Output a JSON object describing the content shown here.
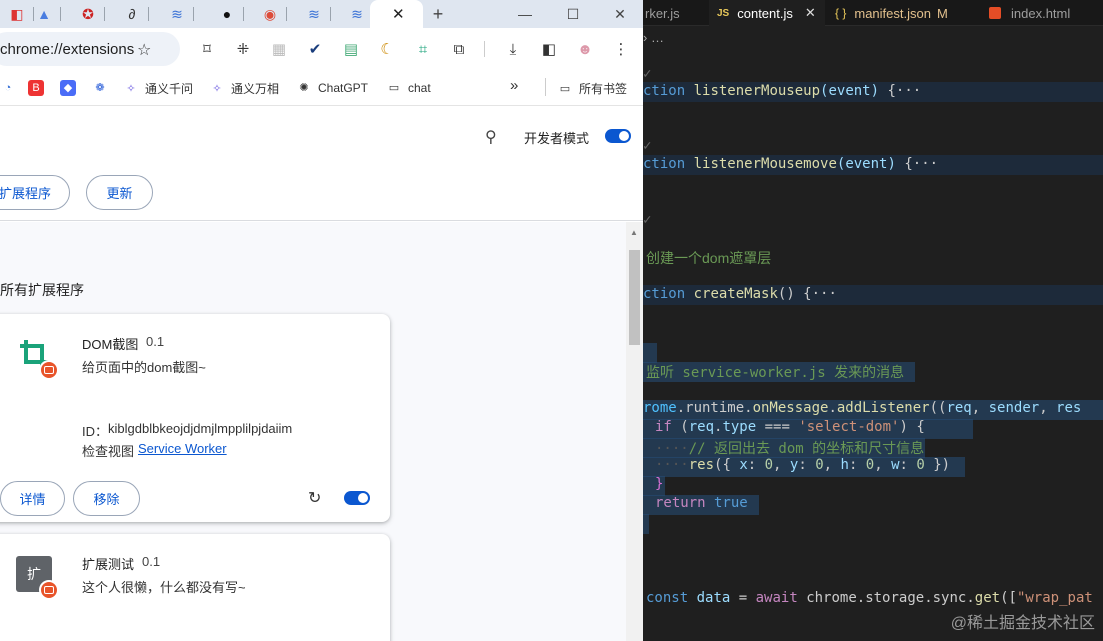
{
  "browser": {
    "url": "chrome://extensions",
    "bookmarks": [
      {
        "label": "通义千问"
      },
      {
        "label": "通义万相"
      },
      {
        "label": "ChatGPT"
      },
      {
        "label": "chat"
      }
    ],
    "bookmarks_overflow": "»",
    "all_bookmarks": "所有书签"
  },
  "extensions_page": {
    "developer_mode_label": "开发者模式",
    "developer_mode_on": true,
    "buttons": {
      "pack": "扩展程序",
      "update": "更新"
    },
    "section_title": "所有扩展程序",
    "cards": [
      {
        "name": "DOM截图",
        "version": "0.1",
        "description": "给页面中的dom截图~",
        "id_label": "ID：",
        "id": "kiblgdblbkeojdjdmjlmpplilpjdaiim",
        "inspect_label": "检查视图",
        "inspect_link": "Service Worker",
        "details_button": "详情",
        "remove_button": "移除",
        "enabled": true
      },
      {
        "name": "扩展测试",
        "version": "0.1",
        "description": "这个人很懒，什么都没有写~",
        "icon_letter": "扩"
      }
    ]
  },
  "editor": {
    "tabs": [
      {
        "label": "rker.js"
      },
      {
        "label": "content.js",
        "badge": "JS"
      },
      {
        "label": "manifest.json",
        "badge": "{ }",
        "modified": "M"
      },
      {
        "label": "index.html"
      }
    ],
    "breadcrumb": "› …",
    "lines": {
      "l1_kw": "ction",
      "l1_fn": "listenerMouseup",
      "l1_p": "(event)",
      "l1_b": " {···",
      "l2_kw": "ction",
      "l2_fn": "listenerMousemove",
      "l2_p": "(event)",
      "l2_b": " {···",
      "l3_cm": "创建一个dom遮罩层",
      "l4_kw": "ction",
      "l4_fn": "createMask",
      "l4_b": "() {···",
      "l5_cm": "监听 service-worker.js 发来的消息",
      "l6_a": "rome",
      "l6_b": ".runtime.",
      "l6_fn": "onMessage",
      "l6_c": ".",
      "l6_fn2": "addListener",
      "l6_d": "((",
      "l6_p": "req",
      "l6_e": ", ",
      "l6_p2": "sender",
      "l6_f": ", ",
      "l6_p3": "res",
      "l7_kw": "if",
      "l7_a": " (",
      "l7_p": "req",
      "l7_b": ".",
      "l7_p2": "type",
      "l7_c": " === ",
      "l7_st": "'select-dom'",
      "l7_d": ") {",
      "l8_cm": "// 返回出去 dom 的坐标和尺寸信息",
      "l9_fn": "res",
      "l9_a": "({ ",
      "l9_k1": "x",
      "l9_s1": ": ",
      "l9_n1": "0",
      "l9_c1": ", ",
      "l9_k2": "y",
      "l9_s2": ": ",
      "l9_n2": "0",
      "l9_c2": ", ",
      "l9_k3": "h",
      "l9_s3": ": ",
      "l9_n3": "0",
      "l9_c3": ", ",
      "l9_k4": "w",
      "l9_s4": ": ",
      "l9_n4": "0",
      "l9_e": " })",
      "l10": "}",
      "l11_cf": "return",
      "l11_kw": " true",
      "l12_kw": "const",
      "l12_p": " data",
      "l12_a": " = ",
      "l12_cf": "await",
      "l12_b": " chrome.storage.sync.",
      "l12_fn": "get",
      "l12_c": "([",
      "l12_st": "\"wrap_pat"
    }
  },
  "watermark": "@稀土掘金技术社区"
}
